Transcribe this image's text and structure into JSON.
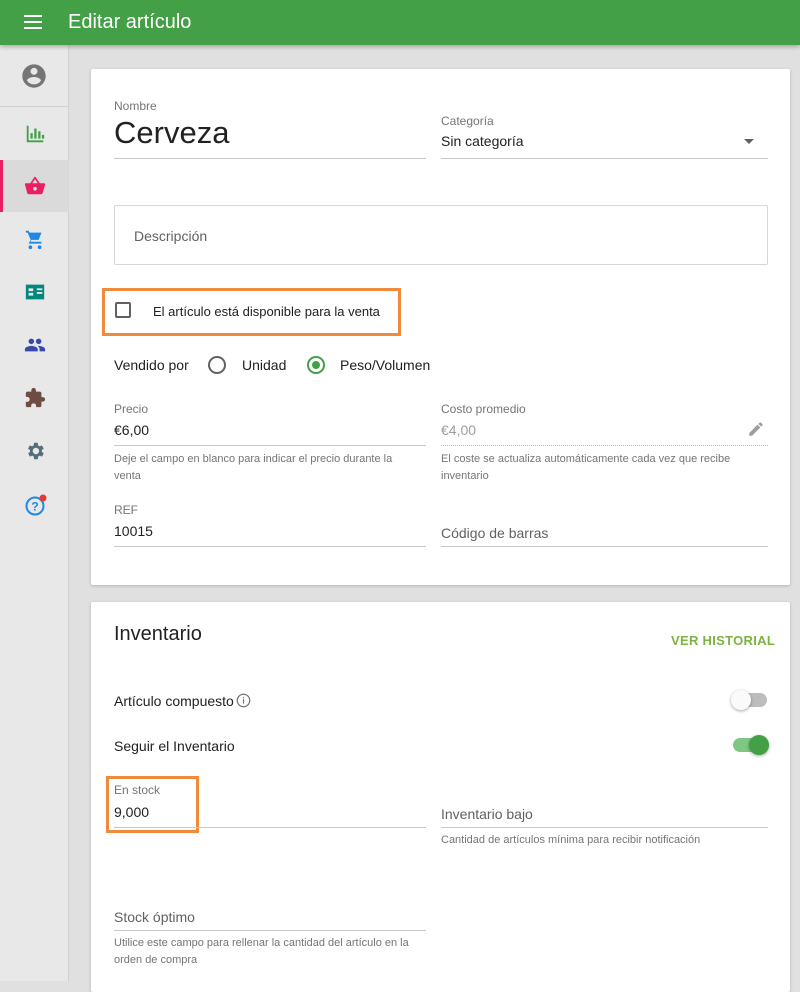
{
  "topbar": {
    "title": "Editar artículo"
  },
  "item": {
    "name_label": "Nombre",
    "name_value": "Cerveza",
    "category_label": "Categoría",
    "category_value": "Sin categoría",
    "description_placeholder": "Descripción",
    "available_label": "El artículo está disponible para la venta",
    "available_checked": false,
    "sold_by_label": "Vendido por",
    "sold_by_options": [
      "Unidad",
      "Peso/Volumen"
    ],
    "sold_by_selected": "Peso/Volumen",
    "price_label": "Precio",
    "price_value": "€6,00",
    "price_helper": [
      "Deje el campo en blanco para indicar el precio durante la",
      "venta"
    ],
    "cost_label": "Costo promedio",
    "cost_value": "€4,00",
    "cost_helper": [
      "El coste se actualiza automáticamente cada vez que recibe",
      "inventario"
    ],
    "ref_label": "REF",
    "ref_value": "10015",
    "barcode_placeholder": "Código de barras"
  },
  "inventory": {
    "title": "Inventario",
    "history_button": "VER HISTORIAL",
    "composite_label": "Artículo compuesto",
    "composite_on": false,
    "track_label": "Seguir el Inventario",
    "track_on": true,
    "in_stock_label": "En stock",
    "in_stock_value": "9,000",
    "low_stock_placeholder": "Inventario bajo",
    "low_stock_helper": "Cantidad de artículos mínima para recibir notificación",
    "optimal_stock_placeholder": "Stock óptimo",
    "optimal_stock_helper": [
      "Utilice este campo para rellenar la cantidad del artículo en la",
      "orden de compra"
    ]
  },
  "colors": {
    "primary": "#43a047",
    "accent_active": "#e91e63",
    "highlight": "#f08a3c"
  },
  "sidebar": {
    "items": [
      {
        "icon": "account-circle-icon"
      },
      {
        "icon": "bar-chart-icon"
      },
      {
        "icon": "basket-icon",
        "active": true
      },
      {
        "icon": "cart-icon"
      },
      {
        "icon": "id-card-icon"
      },
      {
        "icon": "people-icon"
      },
      {
        "icon": "puzzle-icon"
      },
      {
        "icon": "gear-icon"
      },
      {
        "icon": "help-icon"
      }
    ]
  }
}
